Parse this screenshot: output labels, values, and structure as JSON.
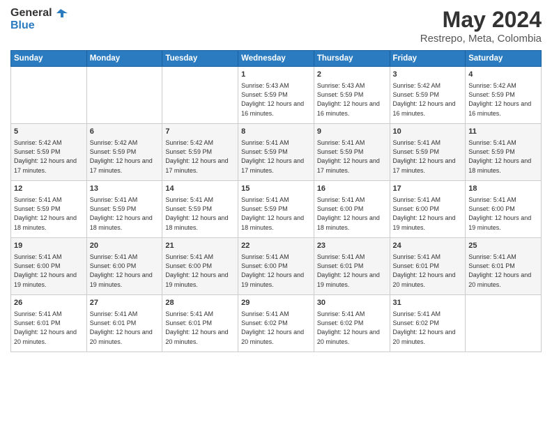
{
  "header": {
    "logo_line1": "General",
    "logo_line2": "Blue",
    "main_title": "May 2024",
    "sub_title": "Restrepo, Meta, Colombia"
  },
  "days_of_week": [
    "Sunday",
    "Monday",
    "Tuesday",
    "Wednesday",
    "Thursday",
    "Friday",
    "Saturday"
  ],
  "weeks": [
    [
      {
        "day": "",
        "info": ""
      },
      {
        "day": "",
        "info": ""
      },
      {
        "day": "",
        "info": ""
      },
      {
        "day": "1",
        "info": "Sunrise: 5:43 AM\nSunset: 5:59 PM\nDaylight: 12 hours\nand 16 minutes."
      },
      {
        "day": "2",
        "info": "Sunrise: 5:43 AM\nSunset: 5:59 PM\nDaylight: 12 hours\nand 16 minutes."
      },
      {
        "day": "3",
        "info": "Sunrise: 5:42 AM\nSunset: 5:59 PM\nDaylight: 12 hours\nand 16 minutes."
      },
      {
        "day": "4",
        "info": "Sunrise: 5:42 AM\nSunset: 5:59 PM\nDaylight: 12 hours\nand 16 minutes."
      }
    ],
    [
      {
        "day": "5",
        "info": "Sunrise: 5:42 AM\nSunset: 5:59 PM\nDaylight: 12 hours\nand 17 minutes."
      },
      {
        "day": "6",
        "info": "Sunrise: 5:42 AM\nSunset: 5:59 PM\nDaylight: 12 hours\nand 17 minutes."
      },
      {
        "day": "7",
        "info": "Sunrise: 5:42 AM\nSunset: 5:59 PM\nDaylight: 12 hours\nand 17 minutes."
      },
      {
        "day": "8",
        "info": "Sunrise: 5:41 AM\nSunset: 5:59 PM\nDaylight: 12 hours\nand 17 minutes."
      },
      {
        "day": "9",
        "info": "Sunrise: 5:41 AM\nSunset: 5:59 PM\nDaylight: 12 hours\nand 17 minutes."
      },
      {
        "day": "10",
        "info": "Sunrise: 5:41 AM\nSunset: 5:59 PM\nDaylight: 12 hours\nand 17 minutes."
      },
      {
        "day": "11",
        "info": "Sunrise: 5:41 AM\nSunset: 5:59 PM\nDaylight: 12 hours\nand 18 minutes."
      }
    ],
    [
      {
        "day": "12",
        "info": "Sunrise: 5:41 AM\nSunset: 5:59 PM\nDaylight: 12 hours\nand 18 minutes."
      },
      {
        "day": "13",
        "info": "Sunrise: 5:41 AM\nSunset: 5:59 PM\nDaylight: 12 hours\nand 18 minutes."
      },
      {
        "day": "14",
        "info": "Sunrise: 5:41 AM\nSunset: 5:59 PM\nDaylight: 12 hours\nand 18 minutes."
      },
      {
        "day": "15",
        "info": "Sunrise: 5:41 AM\nSunset: 5:59 PM\nDaylight: 12 hours\nand 18 minutes."
      },
      {
        "day": "16",
        "info": "Sunrise: 5:41 AM\nSunset: 6:00 PM\nDaylight: 12 hours\nand 18 minutes."
      },
      {
        "day": "17",
        "info": "Sunrise: 5:41 AM\nSunset: 6:00 PM\nDaylight: 12 hours\nand 19 minutes."
      },
      {
        "day": "18",
        "info": "Sunrise: 5:41 AM\nSunset: 6:00 PM\nDaylight: 12 hours\nand 19 minutes."
      }
    ],
    [
      {
        "day": "19",
        "info": "Sunrise: 5:41 AM\nSunset: 6:00 PM\nDaylight: 12 hours\nand 19 minutes."
      },
      {
        "day": "20",
        "info": "Sunrise: 5:41 AM\nSunset: 6:00 PM\nDaylight: 12 hours\nand 19 minutes."
      },
      {
        "day": "21",
        "info": "Sunrise: 5:41 AM\nSunset: 6:00 PM\nDaylight: 12 hours\nand 19 minutes."
      },
      {
        "day": "22",
        "info": "Sunrise: 5:41 AM\nSunset: 6:00 PM\nDaylight: 12 hours\nand 19 minutes."
      },
      {
        "day": "23",
        "info": "Sunrise: 5:41 AM\nSunset: 6:01 PM\nDaylight: 12 hours\nand 19 minutes."
      },
      {
        "day": "24",
        "info": "Sunrise: 5:41 AM\nSunset: 6:01 PM\nDaylight: 12 hours\nand 20 minutes."
      },
      {
        "day": "25",
        "info": "Sunrise: 5:41 AM\nSunset: 6:01 PM\nDaylight: 12 hours\nand 20 minutes."
      }
    ],
    [
      {
        "day": "26",
        "info": "Sunrise: 5:41 AM\nSunset: 6:01 PM\nDaylight: 12 hours\nand 20 minutes."
      },
      {
        "day": "27",
        "info": "Sunrise: 5:41 AM\nSunset: 6:01 PM\nDaylight: 12 hours\nand 20 minutes."
      },
      {
        "day": "28",
        "info": "Sunrise: 5:41 AM\nSunset: 6:01 PM\nDaylight: 12 hours\nand 20 minutes."
      },
      {
        "day": "29",
        "info": "Sunrise: 5:41 AM\nSunset: 6:02 PM\nDaylight: 12 hours\nand 20 minutes."
      },
      {
        "day": "30",
        "info": "Sunrise: 5:41 AM\nSunset: 6:02 PM\nDaylight: 12 hours\nand 20 minutes."
      },
      {
        "day": "31",
        "info": "Sunrise: 5:41 AM\nSunset: 6:02 PM\nDaylight: 12 hours\nand 20 minutes."
      },
      {
        "day": "",
        "info": ""
      }
    ]
  ]
}
